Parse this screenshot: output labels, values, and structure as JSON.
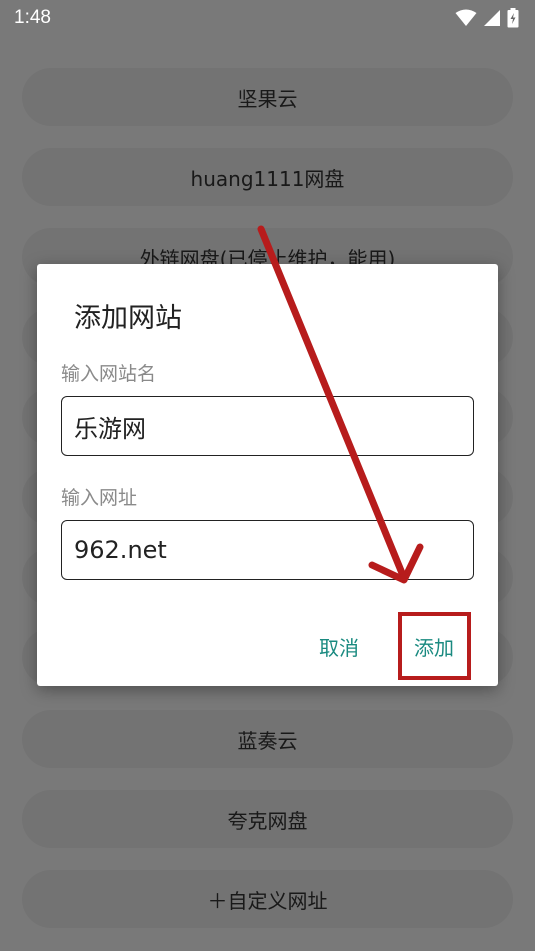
{
  "status_bar": {
    "time": "1:48"
  },
  "background_list": {
    "items": [
      "坚果云",
      "huang1111网盘",
      "外链网盘(已停止维护，能用)",
      "蓝奏云",
      "夸克网盘"
    ],
    "add_custom": "＋自定义网址"
  },
  "dialog": {
    "title": "添加网站",
    "name_label": "输入网站名",
    "name_value": "乐游网",
    "url_label": "输入网址",
    "url_value": "962.net",
    "cancel_label": "取消",
    "add_label": "添加"
  },
  "annotation": {
    "color": "#b71c1c"
  }
}
